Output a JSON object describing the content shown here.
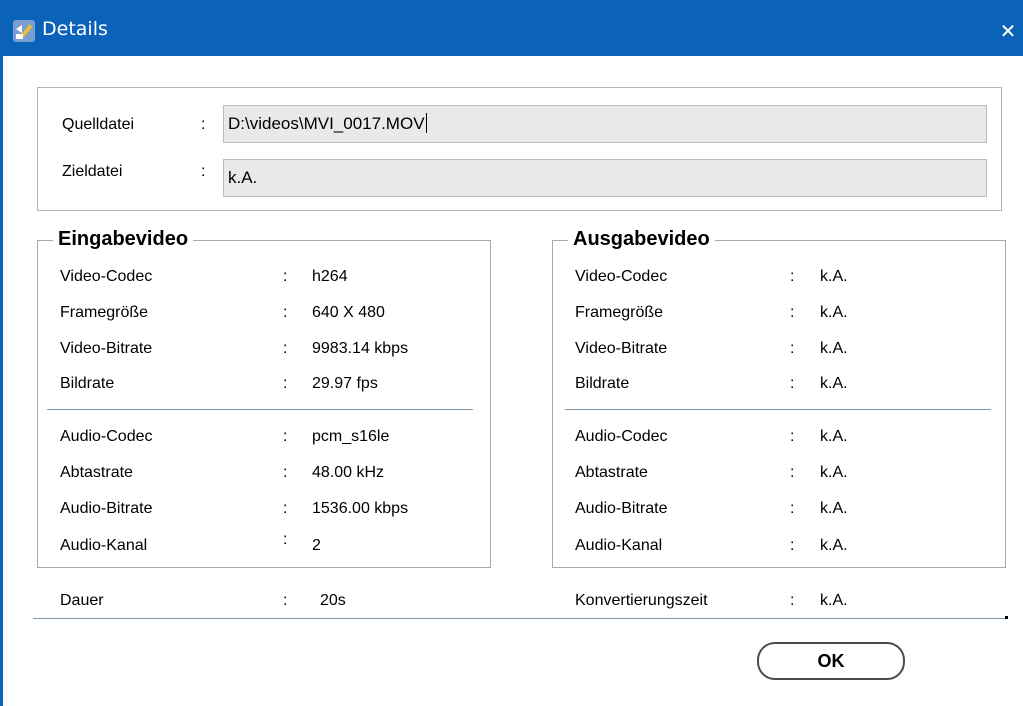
{
  "window": {
    "title": "Details",
    "close_glyph": "✕",
    "icon": "app-logo-icon",
    "accent_color": "#0a63b8"
  },
  "file": {
    "source_label": "Quelldatei",
    "source_value": "D:\\videos\\MVI_0017.MOV",
    "target_label": "Zieldatei",
    "target_value": "k.A.",
    "colon": ":"
  },
  "input_video": {
    "title": "Eingabevideo",
    "video": [
      {
        "label": "Video-Codec",
        "value": "h264"
      },
      {
        "label": "Framegröße",
        "value": "640 X 480"
      },
      {
        "label": "Video-Bitrate",
        "value": "9983.14 kbps"
      },
      {
        "label": "Bildrate",
        "value": "29.97 fps"
      }
    ],
    "audio": [
      {
        "label": "Audio-Codec",
        "value": "pcm_s16le"
      },
      {
        "label": "Abtastrate",
        "value": "48.00 kHz"
      },
      {
        "label": "Audio-Bitrate",
        "value": "1536.00 kbps"
      },
      {
        "label": "Audio-Kanal",
        "value": "2"
      }
    ],
    "duration_label": "Dauer",
    "duration_value": "20s"
  },
  "output_video": {
    "title": "Ausgabevideo",
    "video": [
      {
        "label": "Video-Codec",
        "value": "k.A."
      },
      {
        "label": "Framegröße",
        "value": "k.A."
      },
      {
        "label": "Video-Bitrate",
        "value": "k.A."
      },
      {
        "label": "Bildrate",
        "value": "k.A."
      }
    ],
    "audio": [
      {
        "label": "Audio-Codec",
        "value": "k.A."
      },
      {
        "label": "Abtastrate",
        "value": "k.A."
      },
      {
        "label": "Audio-Bitrate",
        "value": "k.A."
      },
      {
        "label": "Audio-Kanal",
        "value": "k.A."
      }
    ],
    "time_label": "Konvertierungszeit",
    "time_value": "k.A."
  },
  "buttons": {
    "ok_label": "OK"
  },
  "colon": ":"
}
